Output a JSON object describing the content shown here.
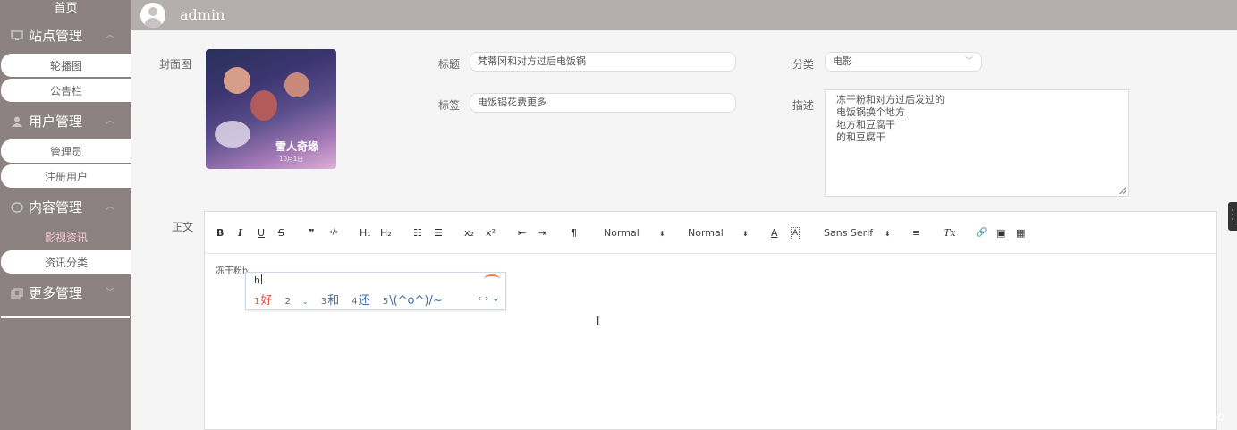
{
  "sidebar": {
    "home": "首页",
    "groups": [
      {
        "title": "站点管理",
        "icon": "monitor-icon",
        "items": [
          "轮播图",
          "公告栏"
        ]
      },
      {
        "title": "用户管理",
        "icon": "user-icon",
        "items": [
          "管理员",
          "注册用户"
        ]
      },
      {
        "title": "内容管理",
        "icon": "chat-icon",
        "items": [
          "影视资讯",
          "资讯分类"
        ],
        "active": "影视资讯"
      },
      {
        "title": "更多管理",
        "icon": "copy-icon",
        "items": []
      }
    ]
  },
  "header": {
    "username": "admin"
  },
  "form": {
    "cover_label": "封面图",
    "cover_title": "雪人奇缘",
    "cover_sub": "10月1日",
    "title_label": "标题",
    "title_value": "梵蒂冈和对方过后电饭锅",
    "tags_label": "标签",
    "tags_value": "电饭锅花费更多",
    "category_label": "分类",
    "category_value": "电影",
    "desc_label": "描述",
    "desc_lines": [
      "冻干粉和对方过后发过的",
      "电饭锅换个地方",
      "地方和豆腐干",
      "的和豆腐干"
    ],
    "body_label": "正文"
  },
  "editor": {
    "toolbar": {
      "bold": "B",
      "italic": "I",
      "underline": "U",
      "strike": "S",
      "quote": "❞",
      "code": "‹/›",
      "h1": "H₁",
      "h2": "H₂",
      "ol": "☷",
      "ul": "☰",
      "sub": "x₂",
      "sup": "x²",
      "outdent": "⇤",
      "indent": "⇥",
      "direction": "¶",
      "size": "Normal",
      "header": "Normal",
      "color": "A",
      "background": "A",
      "font": "Sans Serif",
      "align": "≡",
      "clean": "Tx",
      "link": "🔗",
      "image": "▣",
      "video": "▦"
    },
    "content": "冻干粉h"
  },
  "ime": {
    "pinyin": "h",
    "candidates": [
      {
        "num": "1",
        "text": "好"
      },
      {
        "num": "2",
        "text": ""
      },
      {
        "num": "3",
        "text": "和"
      },
      {
        "num": "4",
        "text": "还"
      },
      {
        "num": "5",
        "text": "\\(^o^)/~"
      }
    ],
    "nav": "‹ › ⌄"
  },
  "watermark": "CSDN @DZBS2000"
}
